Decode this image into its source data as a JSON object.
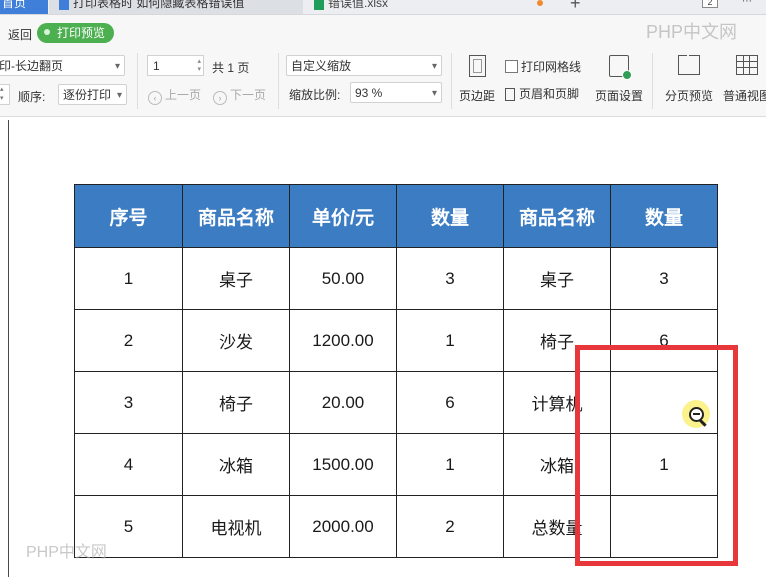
{
  "tabs": [
    {
      "label": "首页"
    },
    {
      "label": "打印表格时 如何隐藏表格错误值"
    },
    {
      "label": "错误值.xlsx"
    }
  ],
  "tab_count": "2",
  "toolbar": {
    "back_label": "返回",
    "print_preview_label": "打印预览",
    "paper_mode": "印-长边翻页",
    "order_label": "顺序:",
    "order_value": "逐份打印",
    "page_number": "1",
    "page_total": "共 1 页",
    "prev_label": "上一页",
    "next_label": "下一页",
    "zoom_mode": "自定义缩放",
    "zoom_ratio_label": "缩放比例:",
    "zoom_ratio_value": "93 %",
    "margin_label": "页边距",
    "gridlines_label": "打印网格线",
    "header_footer_label": "页眉和页脚",
    "page_setup_label": "页面设置",
    "page_break_label": "分页预览",
    "normal_view_label": "普通视图"
  },
  "table": {
    "headers": [
      "序号",
      "商品名称",
      "单价/元",
      "数量",
      "商品名称",
      "数量"
    ],
    "rows": [
      [
        "1",
        "桌子",
        "50.00",
        "3",
        "桌子",
        "3"
      ],
      [
        "2",
        "沙发",
        "1200.00",
        "1",
        "椅子",
        "6"
      ],
      [
        "3",
        "椅子",
        "20.00",
        "6",
        "计算机",
        ""
      ],
      [
        "4",
        "冰箱",
        "1500.00",
        "1",
        "冰箱",
        "1"
      ],
      [
        "5",
        "电视机",
        "2000.00",
        "2",
        "总数量",
        ""
      ]
    ]
  },
  "watermark": "PHP中文网",
  "colors": {
    "header_fill": "#3b7cc3",
    "highlight_box": "#e8373a",
    "preview_badge": "#4caf50"
  }
}
